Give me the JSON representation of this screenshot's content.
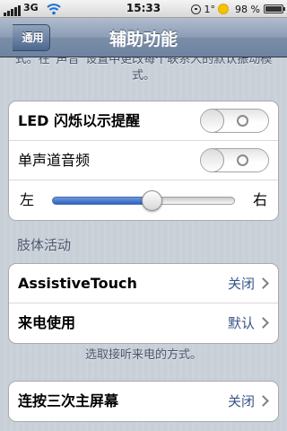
{
  "status_bar": {
    "carrier": "3G",
    "time": "15:33",
    "temperature": "1°",
    "battery_percent": "98 %",
    "battery_level": 0.98
  },
  "nav": {
    "back_label": "通用",
    "title": "辅助功能"
  },
  "top_footnote": "式。在“声音”设置中更改每个联系人的默认振动模式。",
  "audio_group": {
    "led_label": "LED 闪烁以示提醒",
    "led_on": false,
    "mono_label": "单声道音频",
    "mono_on": false,
    "balance_left": "左",
    "balance_right": "右",
    "balance_value": 0.5
  },
  "physical_section": {
    "header": "肢体活动",
    "assistive_label": "AssistiveTouch",
    "assistive_value": "关闭",
    "incoming_label": "来电使用",
    "incoming_value": "默认",
    "incoming_footnote": "选取接听来电的方式。"
  },
  "triple_click": {
    "label": "连按三次主屏幕",
    "value": "关闭"
  },
  "icons": [
    "signal-icon",
    "wifi-icon",
    "rotation-lock-icon",
    "weather-sun-icon",
    "battery-icon",
    "chevron-right-icon"
  ],
  "colors": {
    "nav_bar": "#6d83a1",
    "value_blue": "#385487",
    "slider_fill": "#2e61c0"
  }
}
